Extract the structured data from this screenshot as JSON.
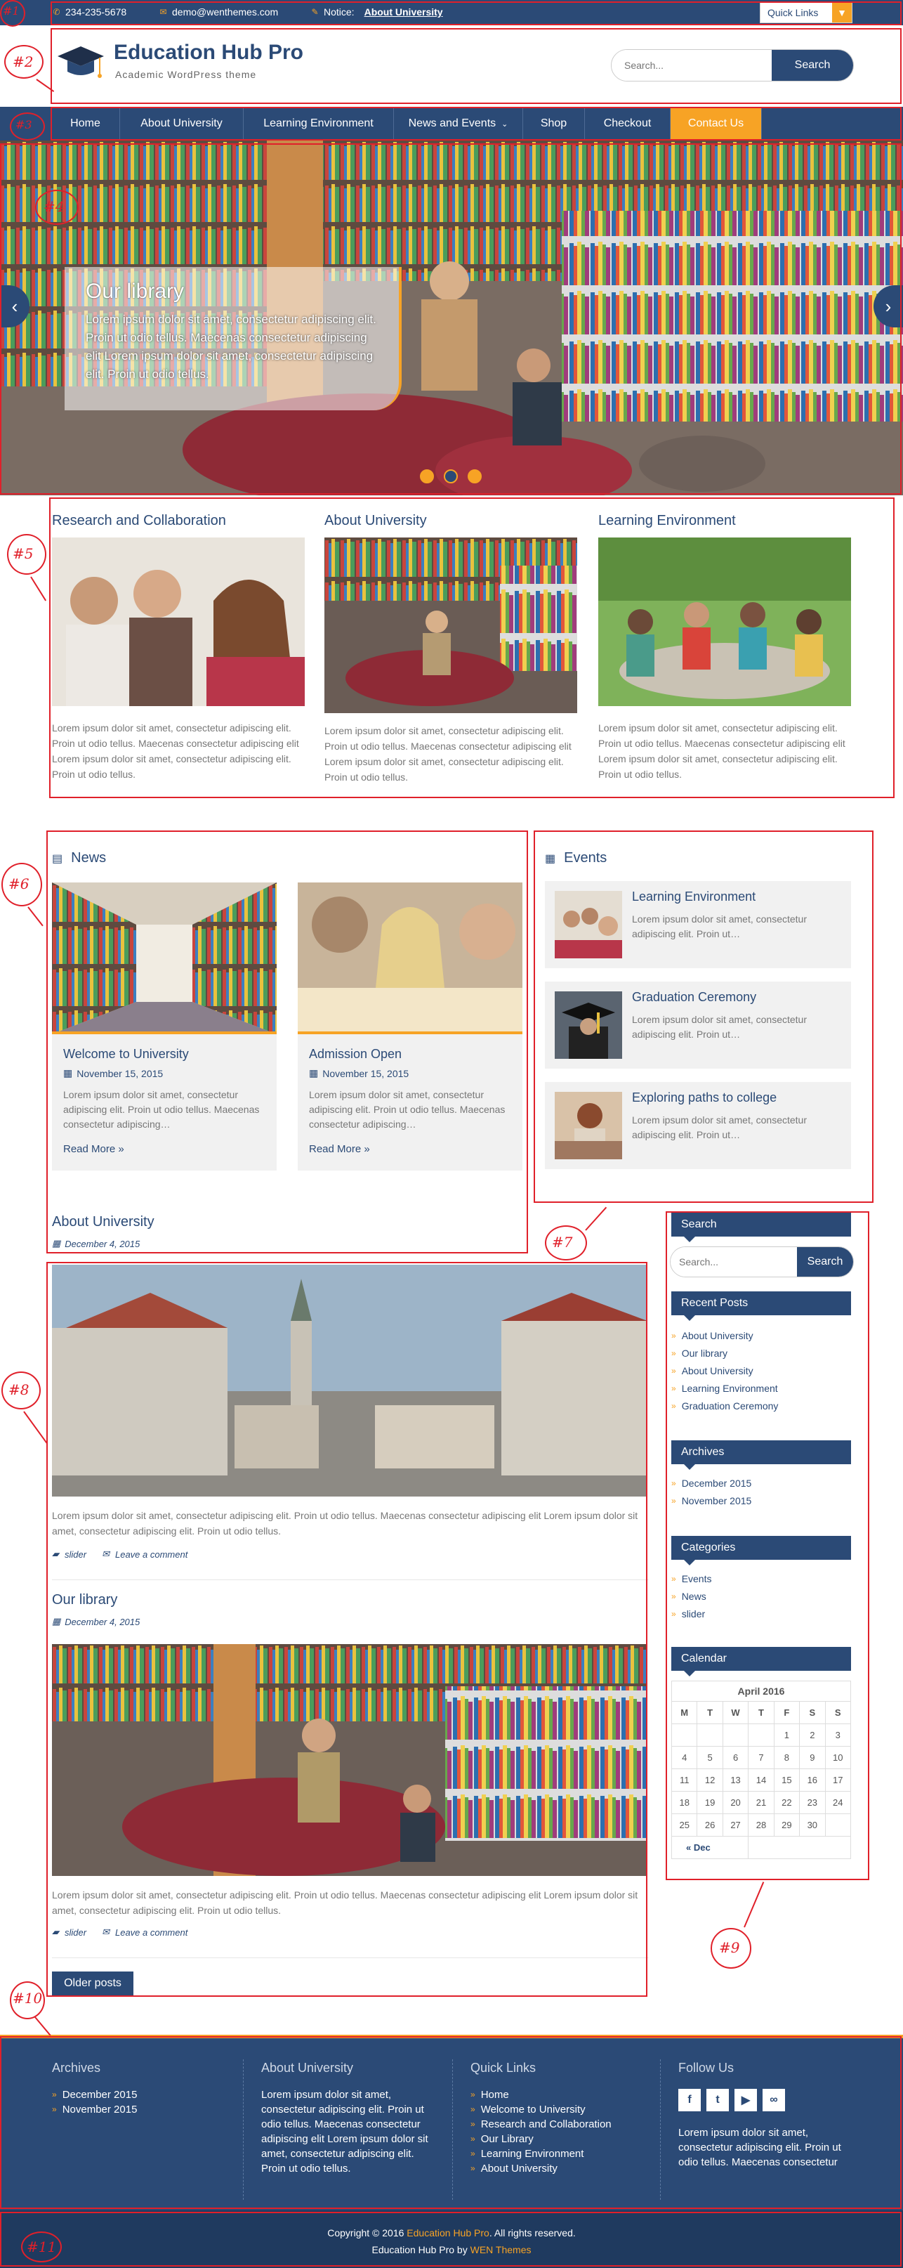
{
  "topbar": {
    "phone": "234-235-5678",
    "email": "demo@wenthemes.com",
    "notice_label": "Notice:",
    "notice_link": "About University",
    "quick_links": "Quick Links"
  },
  "header": {
    "title": "Education Hub Pro",
    "tagline": "Academic WordPress theme",
    "search_placeholder": "Search...",
    "search_button": "Search"
  },
  "nav": [
    {
      "label": "Home"
    },
    {
      "label": "About University"
    },
    {
      "label": "Learning Environment"
    },
    {
      "label": "News and Events"
    },
    {
      "label": "Shop"
    },
    {
      "label": "Checkout"
    },
    {
      "label": "Contact Us"
    }
  ],
  "slider": {
    "title": "Our library",
    "text": "Lorem ipsum dolor sit amet, consectetur adipiscing elit. Proin ut odio tellus. Maecenas consectetur adipiscing elit Lorem ipsum dolor sit amet, consectetur adipiscing elit. Proin ut odio tellus."
  },
  "featured": [
    {
      "title": "Research and Collaboration",
      "text": "Lorem ipsum dolor sit amet, consectetur adipiscing elit. Proin ut odio tellus. Maecenas consectetur adipiscing elit Lorem ipsum dolor sit amet, consectetur adipiscing elit. Proin ut odio tellus."
    },
    {
      "title": "About University",
      "text": "Lorem ipsum dolor sit amet, consectetur adipiscing elit. Proin ut odio tellus. Maecenas consectetur adipiscing elit Lorem ipsum dolor sit amet, consectetur adipiscing elit. Proin ut odio tellus."
    },
    {
      "title": "Learning Environment",
      "text": "Lorem ipsum dolor sit amet, consectetur adipiscing elit. Proin ut odio tellus. Maecenas consectetur adipiscing elit Lorem ipsum dolor sit amet, consectetur adipiscing elit. Proin ut odio tellus."
    }
  ],
  "news": {
    "heading": "News",
    "items": [
      {
        "title": "Welcome to University",
        "date": "November 15, 2015",
        "excerpt": "Lorem ipsum dolor sit amet, consectetur adipiscing elit. Proin ut odio tellus. Maecenas consectetur adipiscing…",
        "more": "Read More »"
      },
      {
        "title": "Admission Open",
        "date": "November 15, 2015",
        "excerpt": "Lorem ipsum dolor sit amet, consectetur adipiscing elit. Proin ut odio tellus. Maecenas consectetur adipiscing…",
        "more": "Read More »"
      }
    ]
  },
  "events": {
    "heading": "Events",
    "items": [
      {
        "title": "Learning Environment",
        "excerpt": "Lorem ipsum dolor sit amet, consectetur adipiscing elit. Proin ut…"
      },
      {
        "title": "Graduation Ceremony",
        "excerpt": "Lorem ipsum dolor sit amet, consectetur adipiscing elit. Proin ut…"
      },
      {
        "title": "Exploring paths to college",
        "excerpt": "Lorem ipsum dolor sit amet, consectetur adipiscing elit. Proin ut…"
      }
    ]
  },
  "posts": [
    {
      "title": "About University",
      "date": "December 4, 2015",
      "text": "Lorem ipsum dolor sit amet, consectetur adipiscing elit. Proin ut odio tellus. Maecenas consectetur adipiscing elit Lorem ipsum dolor sit amet, consectetur adipiscing elit. Proin ut odio tellus.",
      "category": "slider",
      "comment": "Leave a comment"
    },
    {
      "title": "Our library",
      "date": "December 4, 2015",
      "text": "Lorem ipsum dolor sit amet, consectetur adipiscing elit. Proin ut odio tellus. Maecenas consectetur adipiscing elit Lorem ipsum dolor sit amet, consectetur adipiscing elit. Proin ut odio tellus.",
      "category": "slider",
      "comment": "Leave a comment"
    }
  ],
  "older_posts": "Older posts",
  "sidebar": {
    "search_title": "Search",
    "search_placeholder": "Search...",
    "search_button": "Search",
    "recent_title": "Recent Posts",
    "recent": [
      "About University",
      "Our library",
      "About University",
      "Learning Environment",
      "Graduation Ceremony"
    ],
    "archives_title": "Archives",
    "archives": [
      "December 2015",
      "November 2015"
    ],
    "categories_title": "Categories",
    "categories": [
      "Events",
      "News",
      "slider"
    ],
    "calendar_title": "Calendar",
    "calendar": {
      "caption": "April 2016",
      "days": [
        "M",
        "T",
        "W",
        "T",
        "F",
        "S",
        "S"
      ],
      "weeks": [
        [
          "",
          "",
          "",
          "",
          "1",
          "2",
          "3"
        ],
        [
          "4",
          "5",
          "6",
          "7",
          "8",
          "9",
          "10"
        ],
        [
          "11",
          "12",
          "13",
          "14",
          "15",
          "16",
          "17"
        ],
        [
          "18",
          "19",
          "20",
          "21",
          "22",
          "23",
          "24"
        ],
        [
          "25",
          "26",
          "27",
          "28",
          "29",
          "30",
          ""
        ]
      ],
      "prev": "« Dec"
    }
  },
  "footer": {
    "archives_title": "Archives",
    "archives": [
      "December 2015",
      "November 2015"
    ],
    "about_title": "About University",
    "about_text": "Lorem ipsum dolor sit amet, consectetur adipiscing elit. Proin ut odio tellus. Maecenas consectetur adipiscing elit Lorem ipsum dolor sit amet, consectetur adipiscing elit. Proin ut odio tellus.",
    "quick_title": "Quick Links",
    "quick": [
      "Home",
      "Welcome to University",
      "Research and Collaboration",
      "Our Library",
      "Learning Environment",
      "About University"
    ],
    "follow_title": "Follow Us",
    "follow_text": "Lorem ipsum dolor sit amet, consectetur adipiscing elit. Proin ut odio tellus. Maecenas consectetur",
    "copyright_pre": "Copyright © 2016",
    "copyright_site": "Education Hub Pro",
    "copyright_post": ". All rights reserved.",
    "credit_pre": "Education Hub Pro by",
    "credit_link": "WEN Themes"
  },
  "annotations": [
    "#1",
    "#2",
    "#3",
    "#4",
    "#5",
    "#6",
    "#7",
    "#8",
    "#9",
    "#10",
    "#11"
  ],
  "colors": {
    "primary": "#2b4a76",
    "accent": "#f7a325",
    "annotation": "#e0202a"
  }
}
